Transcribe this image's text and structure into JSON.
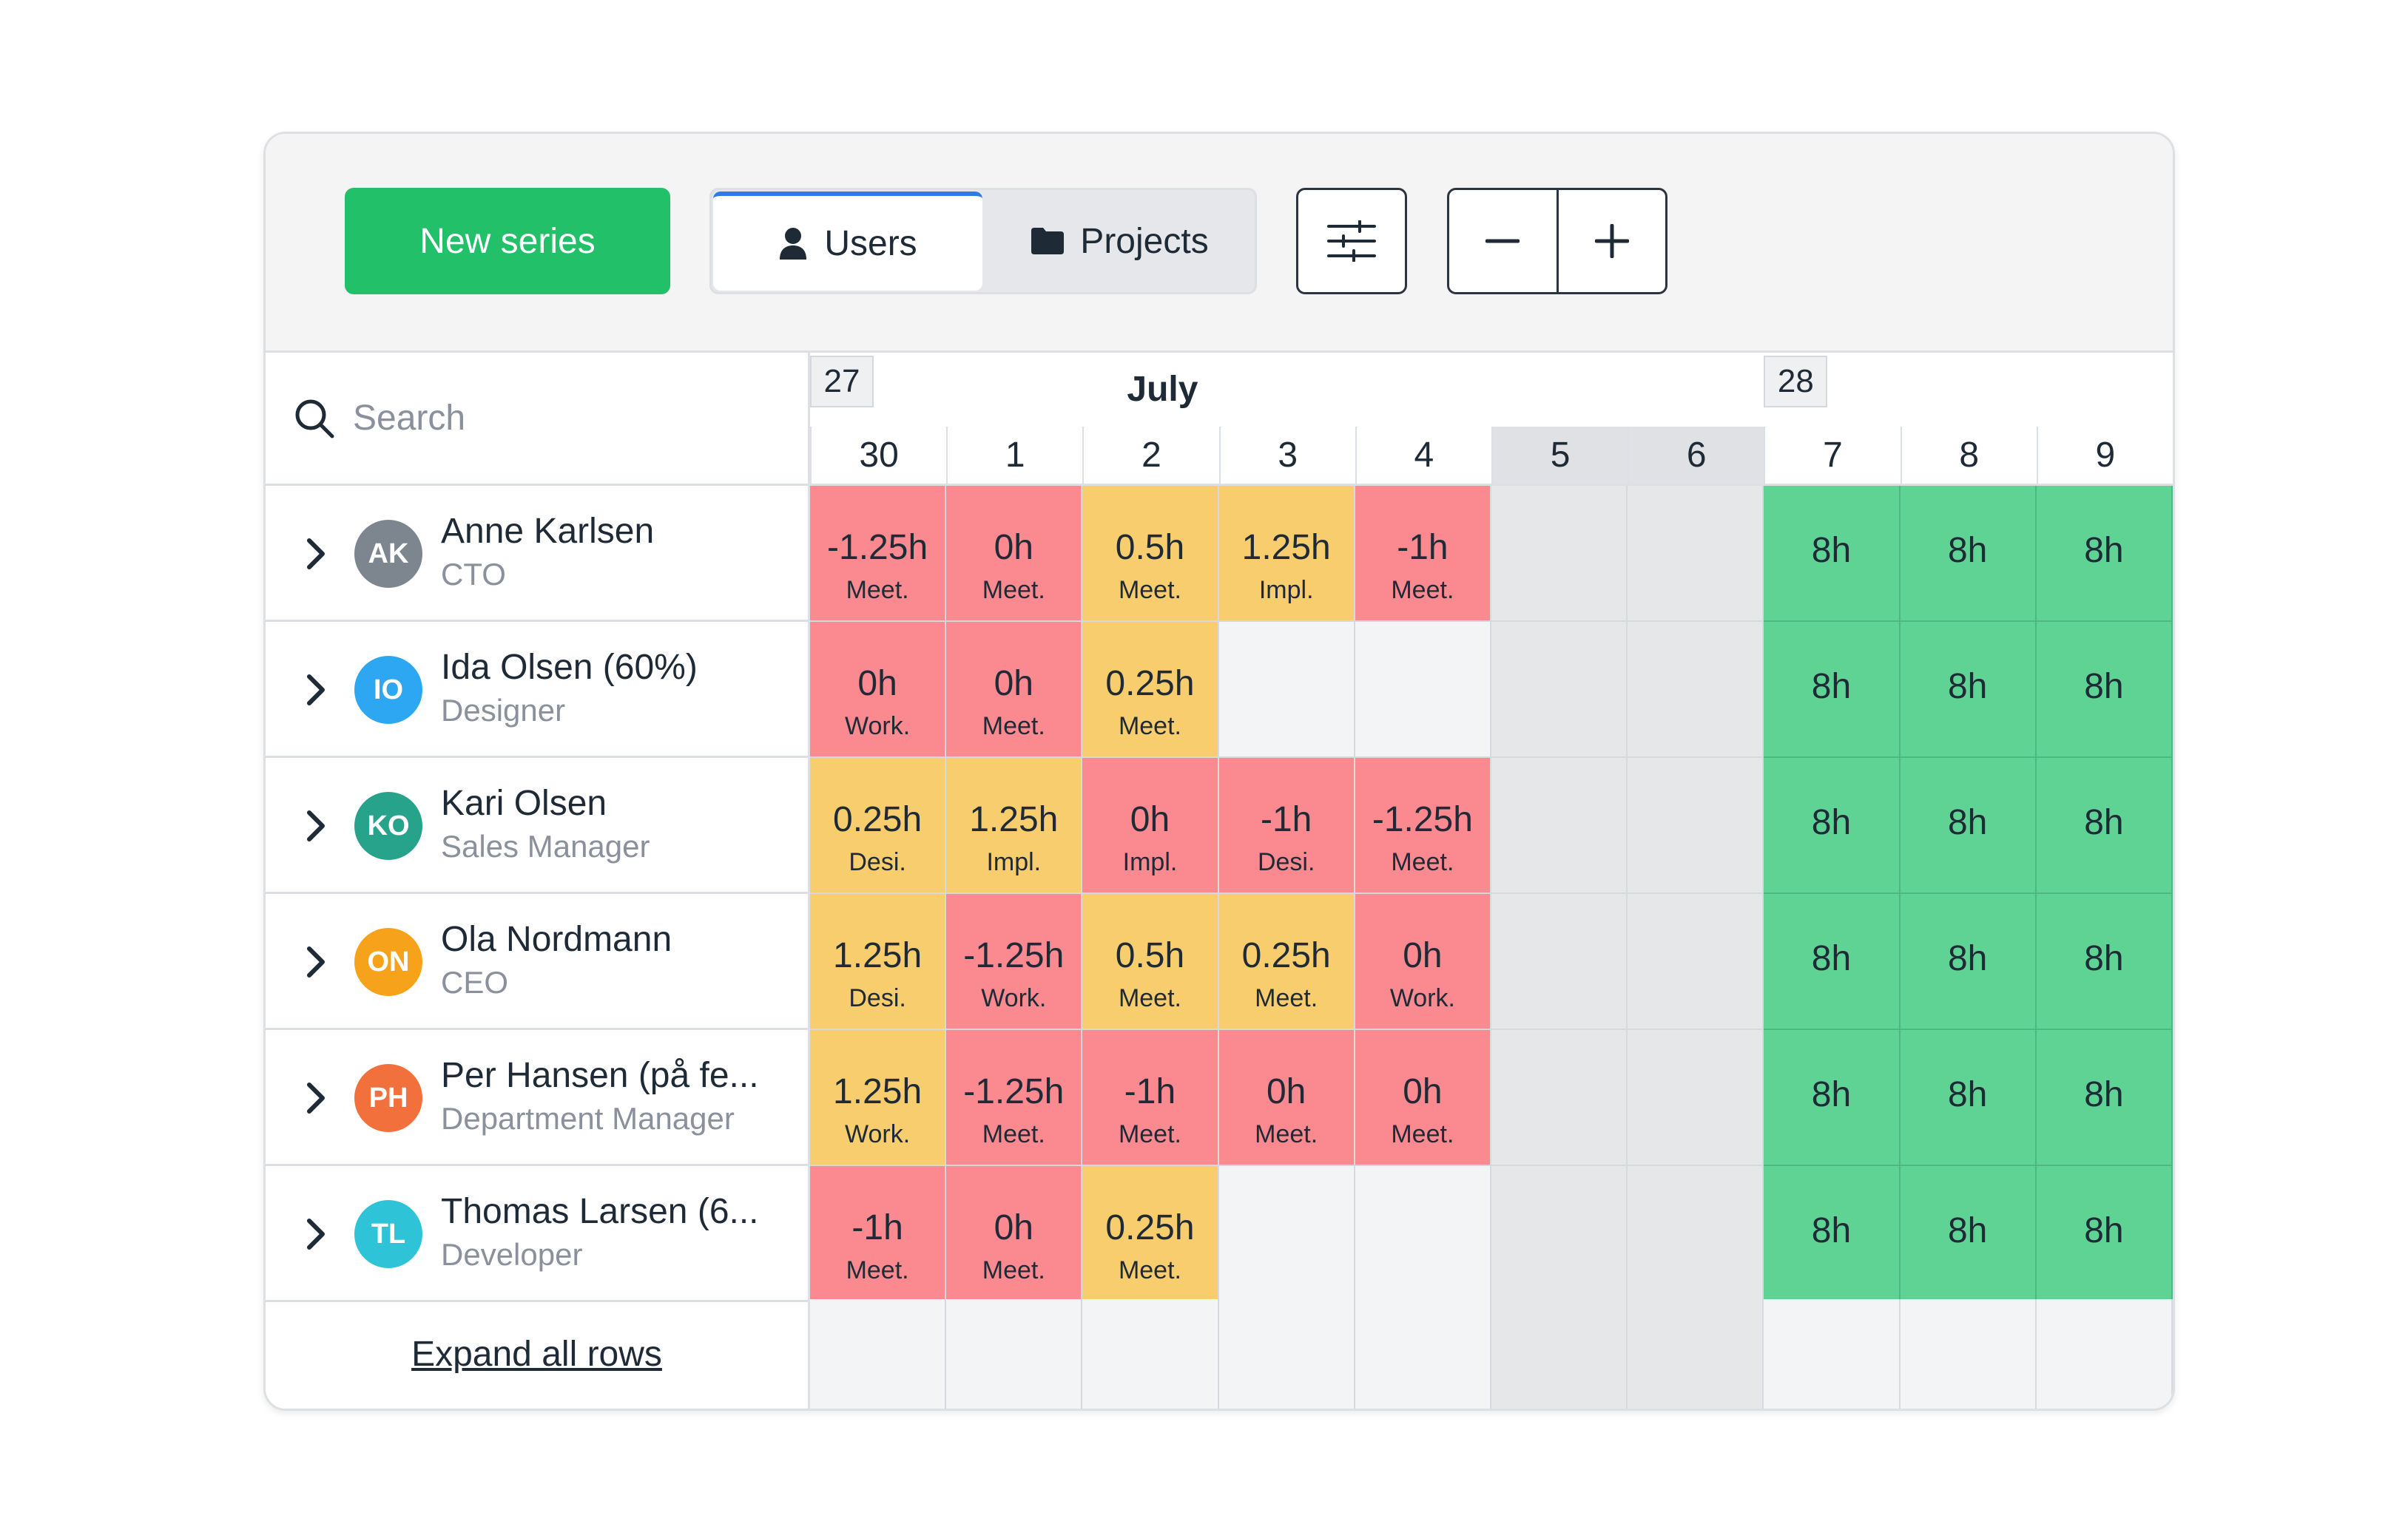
{
  "toolbar": {
    "new_series_label": "New series",
    "users_tab_label": "Users",
    "projects_tab_label": "Projects",
    "zoom_out_icon": "minus-icon",
    "zoom_in_icon": "plus-icon",
    "filter_icon": "sliders-icon"
  },
  "search": {
    "placeholder": "Search"
  },
  "calendar": {
    "month": "July",
    "weeks": [
      {
        "label": "27"
      },
      {
        "label": "28"
      }
    ],
    "days": [
      {
        "label": "30",
        "weekend": false
      },
      {
        "label": "1",
        "weekend": false
      },
      {
        "label": "2",
        "weekend": false
      },
      {
        "label": "3",
        "weekend": false
      },
      {
        "label": "4",
        "weekend": false
      },
      {
        "label": "5",
        "weekend": true
      },
      {
        "label": "6",
        "weekend": true
      },
      {
        "label": "7",
        "weekend": false
      },
      {
        "label": "8",
        "weekend": false
      },
      {
        "label": "9",
        "weekend": false
      }
    ]
  },
  "users": [
    {
      "initials": "AK",
      "name": "Anne Karlsen",
      "role": "CTO",
      "avatar_color": "#7d868f",
      "cells": [
        {
          "hours": "-1.25h",
          "type": "Meet.",
          "status": "red"
        },
        {
          "hours": "0h",
          "type": "Meet.",
          "status": "red"
        },
        {
          "hours": "0.5h",
          "type": "Meet.",
          "status": "yellow"
        },
        {
          "hours": "1.25h",
          "type": "Impl.",
          "status": "yellow"
        },
        {
          "hours": "-1h",
          "type": "Meet.",
          "status": "red"
        },
        {
          "hours": "",
          "type": "",
          "status": "weekend"
        },
        {
          "hours": "",
          "type": "",
          "status": "weekend"
        },
        {
          "hours": "8h",
          "type": "",
          "status": "green"
        },
        {
          "hours": "8h",
          "type": "",
          "status": "green"
        },
        {
          "hours": "8h",
          "type": "",
          "status": "green"
        }
      ]
    },
    {
      "initials": "IO",
      "name": "Ida Olsen (60%)",
      "role": "Designer",
      "avatar_color": "#2ea7f2",
      "cells": [
        {
          "hours": "0h",
          "type": "Work.",
          "status": "red"
        },
        {
          "hours": "0h",
          "type": "Meet.",
          "status": "red"
        },
        {
          "hours": "0.25h",
          "type": "Meet.",
          "status": "yellow"
        },
        {
          "hours": "",
          "type": "",
          "status": "empty"
        },
        {
          "hours": "",
          "type": "",
          "status": "empty"
        },
        {
          "hours": "",
          "type": "",
          "status": "weekend"
        },
        {
          "hours": "",
          "type": "",
          "status": "weekend"
        },
        {
          "hours": "8h",
          "type": "",
          "status": "green"
        },
        {
          "hours": "8h",
          "type": "",
          "status": "green"
        },
        {
          "hours": "8h",
          "type": "",
          "status": "green"
        }
      ]
    },
    {
      "initials": "KO",
      "name": "Kari Olsen",
      "role": "Sales Manager",
      "avatar_color": "#26a38a",
      "cells": [
        {
          "hours": "0.25h",
          "type": "Desi.",
          "status": "yellow"
        },
        {
          "hours": "1.25h",
          "type": "Impl.",
          "status": "yellow"
        },
        {
          "hours": "0h",
          "type": "Impl.",
          "status": "red"
        },
        {
          "hours": "-1h",
          "type": "Desi.",
          "status": "red"
        },
        {
          "hours": "-1.25h",
          "type": "Meet.",
          "status": "red"
        },
        {
          "hours": "",
          "type": "",
          "status": "weekend"
        },
        {
          "hours": "",
          "type": "",
          "status": "weekend"
        },
        {
          "hours": "8h",
          "type": "",
          "status": "green"
        },
        {
          "hours": "8h",
          "type": "",
          "status": "green"
        },
        {
          "hours": "8h",
          "type": "",
          "status": "green"
        }
      ]
    },
    {
      "initials": "ON",
      "name": "Ola Nordmann",
      "role": "CEO",
      "avatar_color": "#f7a21b",
      "cells": [
        {
          "hours": "1.25h",
          "type": "Desi.",
          "status": "yellow"
        },
        {
          "hours": "-1.25h",
          "type": "Work.",
          "status": "red"
        },
        {
          "hours": "0.5h",
          "type": "Meet.",
          "status": "yellow"
        },
        {
          "hours": "0.25h",
          "type": "Meet.",
          "status": "yellow"
        },
        {
          "hours": "0h",
          "type": "Work.",
          "status": "red"
        },
        {
          "hours": "",
          "type": "",
          "status": "weekend"
        },
        {
          "hours": "",
          "type": "",
          "status": "weekend"
        },
        {
          "hours": "8h",
          "type": "",
          "status": "green"
        },
        {
          "hours": "8h",
          "type": "",
          "status": "green"
        },
        {
          "hours": "8h",
          "type": "",
          "status": "green"
        }
      ]
    },
    {
      "initials": "PH",
      "name": "Per Hansen (på fe...",
      "role": "Department Manager",
      "avatar_color": "#f2703c",
      "cells": [
        {
          "hours": "1.25h",
          "type": "Work.",
          "status": "yellow"
        },
        {
          "hours": "-1.25h",
          "type": "Meet.",
          "status": "red"
        },
        {
          "hours": "-1h",
          "type": "Meet.",
          "status": "red"
        },
        {
          "hours": "0h",
          "type": "Meet.",
          "status": "red"
        },
        {
          "hours": "0h",
          "type": "Meet.",
          "status": "red"
        },
        {
          "hours": "",
          "type": "",
          "status": "weekend"
        },
        {
          "hours": "",
          "type": "",
          "status": "weekend"
        },
        {
          "hours": "8h",
          "type": "",
          "status": "green"
        },
        {
          "hours": "8h",
          "type": "",
          "status": "green"
        },
        {
          "hours": "8h",
          "type": "",
          "status": "green"
        }
      ]
    },
    {
      "initials": "TL",
      "name": "Thomas Larsen (6...",
      "role": "Developer",
      "avatar_color": "#2ec3d6",
      "cells": [
        {
          "hours": "-1h",
          "type": "Meet.",
          "status": "red"
        },
        {
          "hours": "0h",
          "type": "Meet.",
          "status": "red"
        },
        {
          "hours": "0.25h",
          "type": "Meet.",
          "status": "yellow"
        },
        {
          "hours": "",
          "type": "",
          "status": "empty"
        },
        {
          "hours": "",
          "type": "",
          "status": "empty"
        },
        {
          "hours": "",
          "type": "",
          "status": "weekend"
        },
        {
          "hours": "",
          "type": "",
          "status": "weekend"
        },
        {
          "hours": "8h",
          "type": "",
          "status": "green"
        },
        {
          "hours": "8h",
          "type": "",
          "status": "green"
        },
        {
          "hours": "8h",
          "type": "",
          "status": "green"
        }
      ]
    }
  ],
  "footer": {
    "expand_label": "Expand all rows"
  },
  "colors": {
    "accent_green": "#22c069",
    "cell_red": "#fa8a8f",
    "cell_yellow": "#f7cd6e",
    "cell_green": "#5fd394",
    "tab_active": "#2e7be5"
  }
}
